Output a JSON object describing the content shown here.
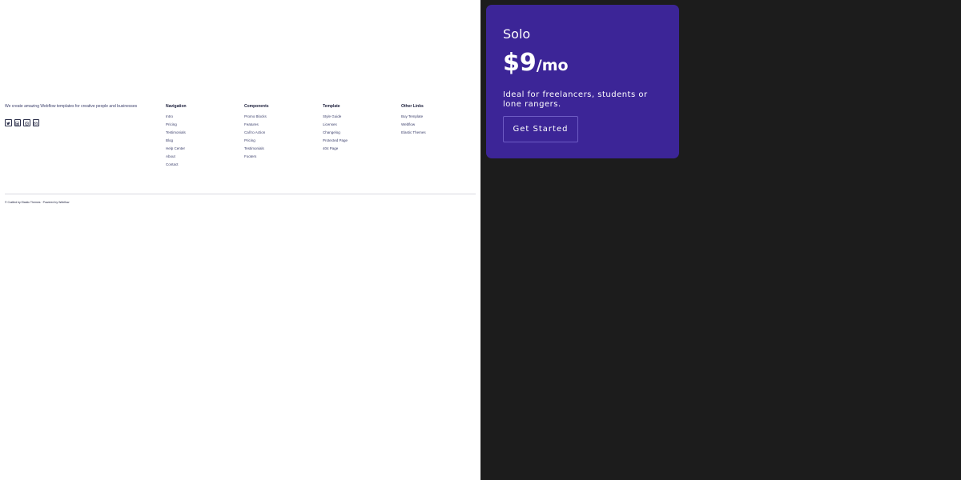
{
  "footer": {
    "brand_text": "We create amazing Webflow templates for creative people and businesses",
    "socials": [
      {
        "icon": "twitter-icon"
      },
      {
        "icon": "linkedin-icon"
      },
      {
        "icon": "instagram-icon"
      },
      {
        "icon": "email-icon"
      }
    ],
    "columns": [
      {
        "heading": "Navigation",
        "links": [
          "Intro",
          "Pricing",
          "Testimonials",
          "Blog",
          "Help Center",
          "About",
          "Contact"
        ]
      },
      {
        "heading": "Components",
        "links": [
          "Promo Blocks",
          "Features",
          "Call to Action",
          "Pricing",
          "Testimonials",
          "Footers"
        ]
      },
      {
        "heading": "Template",
        "links": [
          "Style Guide",
          "Licenses",
          "Changelog",
          "Protected Page",
          "404 Page"
        ]
      },
      {
        "heading": "Other Links",
        "links": [
          "Buy Template",
          "Webflow",
          "Elastic Themes"
        ]
      }
    ],
    "copyright": "© Crafted by Elastic Themes · Powered by Webflow"
  },
  "pricing": {
    "plan": "Solo",
    "price_amount": "$9",
    "price_period": "/mo",
    "description": "Ideal for freelancers, students or lone rangers.",
    "cta_label": "Get Started"
  },
  "colors": {
    "card_bg": "#3c2597",
    "dark_bg": "#1c1c1c",
    "link": "#3b3f6b"
  }
}
